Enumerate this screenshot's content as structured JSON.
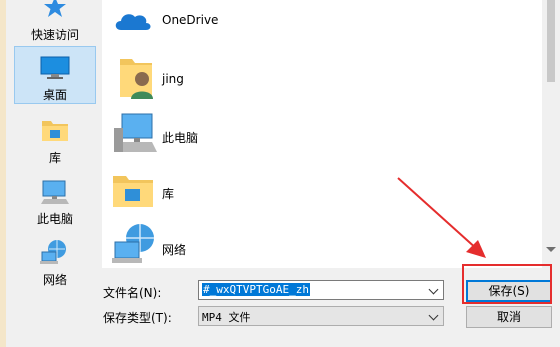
{
  "nav": {
    "items": [
      {
        "label": "快速访问",
        "icon": "star-icon"
      },
      {
        "label": "桌面",
        "icon": "desktop-icon"
      },
      {
        "label": "库",
        "icon": "library-icon"
      },
      {
        "label": "此电脑",
        "icon": "computer-icon"
      },
      {
        "label": "网络",
        "icon": "network-icon"
      }
    ]
  },
  "files": [
    {
      "name": "OneDrive",
      "icon": "onedrive-icon"
    },
    {
      "name": "jing",
      "icon": "user-folder-icon"
    },
    {
      "name": "此电脑",
      "icon": "computer-icon"
    },
    {
      "name": "库",
      "icon": "library-icon"
    },
    {
      "name": "网络",
      "icon": "network-icon"
    }
  ],
  "form": {
    "filename_label": "文件名(N):",
    "filename_value": "#_wxQTVPTGoAE_zh",
    "filetype_label": "保存类型(T):",
    "filetype_value": "MP4 文件"
  },
  "buttons": {
    "save": "保存(S)",
    "cancel": "取消"
  },
  "colors": {
    "selection": "#cce4f7",
    "accent": "#0078d7",
    "annotation": "#e52d2d"
  }
}
